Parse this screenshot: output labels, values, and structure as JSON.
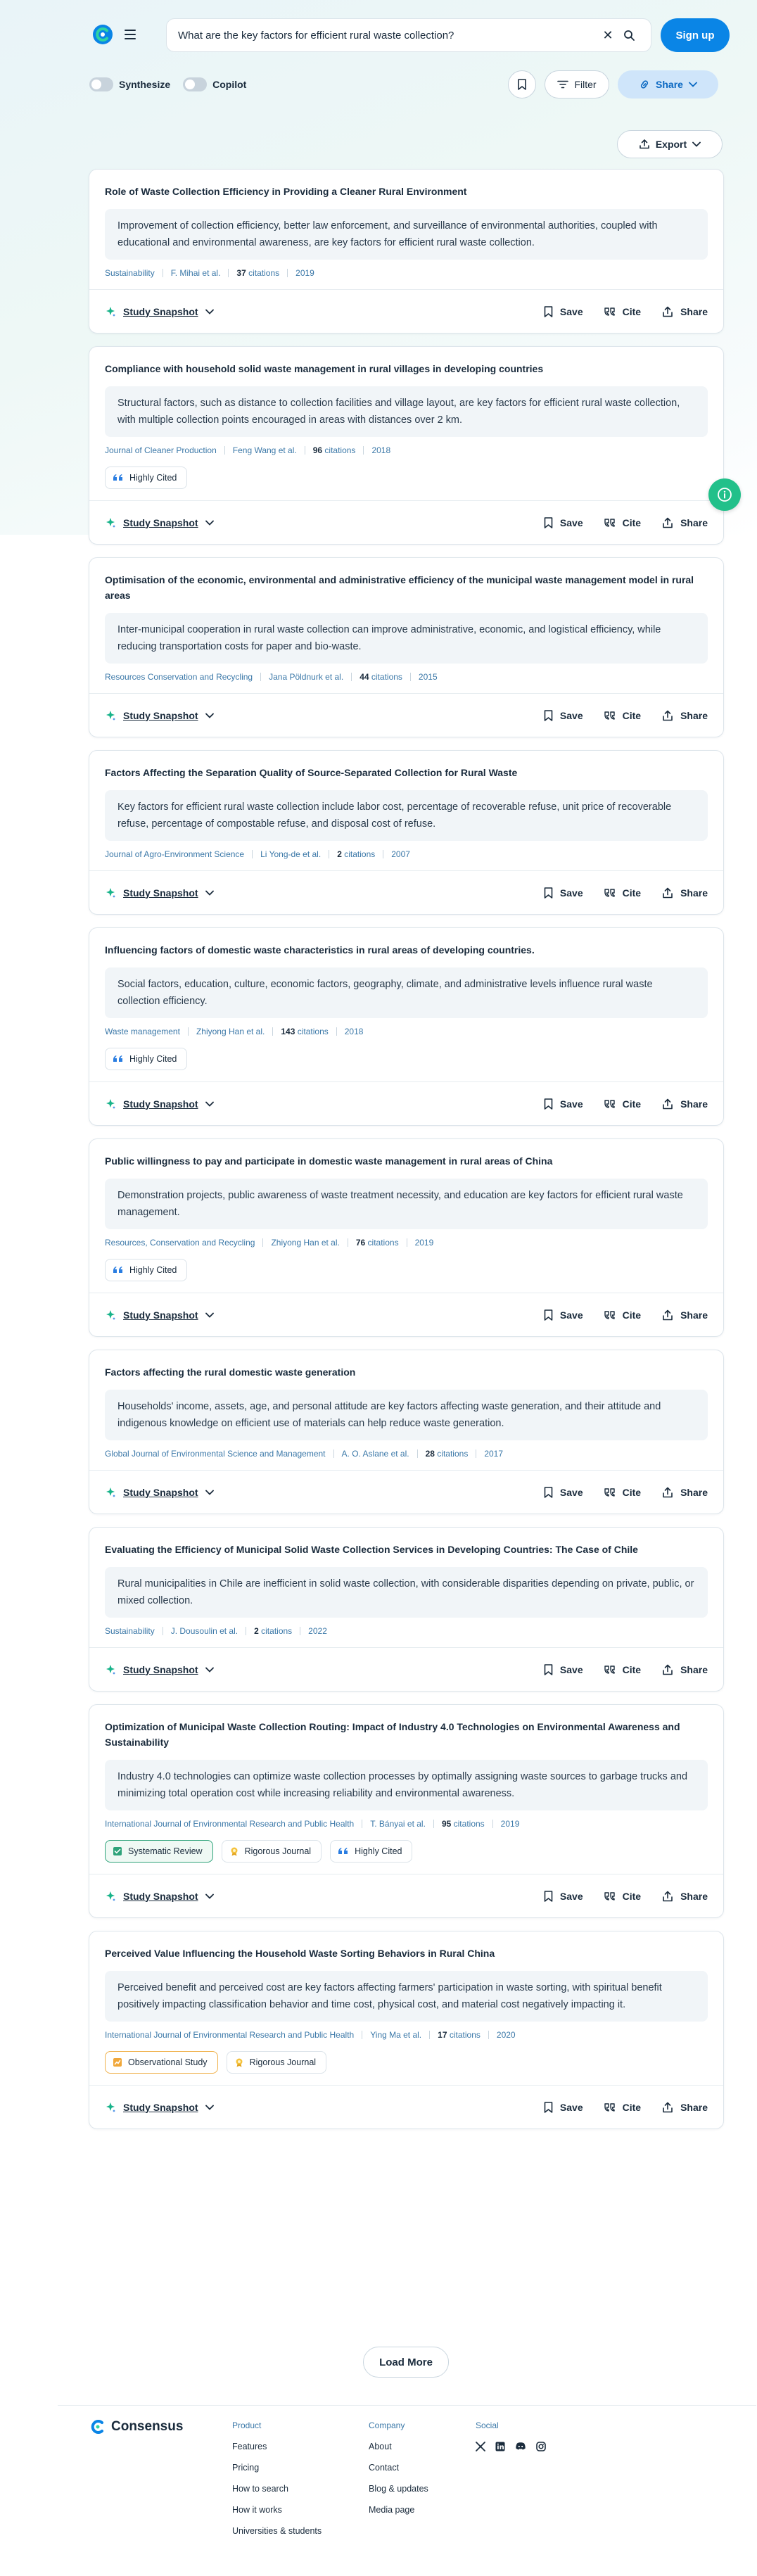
{
  "header": {
    "search_query": "What are the key factors for efficient rural waste collection?",
    "signup_label": "Sign up"
  },
  "toggles": [
    {
      "label": "Synthesize"
    },
    {
      "label": "Copilot"
    }
  ],
  "actions": {
    "filter_label": "Filter",
    "share_label": "Share",
    "export_label": "Export"
  },
  "card_actions": {
    "snapshot_label": "Study Snapshot",
    "save_label": "Save",
    "cite_label": "Cite",
    "share_label": "Share"
  },
  "results": [
    {
      "title": "Role of Waste Collection Efficiency in Providing a Cleaner Rural Environment",
      "summary": "Improvement of collection efficiency, better law enforcement, and surveillance of environmental authorities, coupled with educational and environmental awareness, are key factors for efficient rural waste collection.",
      "journal": "Sustainability",
      "authors": "F. Mihai et al.",
      "citations": "37",
      "citations_label": "citations",
      "year": "2019",
      "badges": []
    },
    {
      "title": "Compliance with household solid waste management in rural villages in developing countries",
      "summary": "Structural factors, such as distance to collection facilities and village layout, are key factors for efficient rural waste collection, with multiple collection points encouraged in areas with distances over 2 km.",
      "journal": "Journal of Cleaner Production",
      "authors": "Feng Wang et al.",
      "citations": "96",
      "citations_label": "citations",
      "year": "2018",
      "badges": [
        {
          "label": "Highly Cited",
          "type": "cited"
        }
      ]
    },
    {
      "title": "Optimisation of the economic, environmental and administrative efficiency of the municipal waste management model in rural areas",
      "summary": "Inter-municipal cooperation in rural waste collection can improve administrative, economic, and logistical efficiency, while reducing transportation costs for paper and bio-waste.",
      "journal": "Resources Conservation and Recycling",
      "authors": "Jana Pöldnurk et al.",
      "citations": "44",
      "citations_label": "citations",
      "year": "2015",
      "badges": []
    },
    {
      "title": "Factors Affecting the Separation Quality of Source-Separated Collection for Rural Waste",
      "summary": "Key factors for efficient rural waste collection include labor cost, percentage of recoverable refuse, unit price of recoverable refuse, percentage of compostable refuse, and disposal cost of refuse.",
      "journal": "Journal of Agro-Environment Science",
      "authors": "Li Yong-de et al.",
      "citations": "2",
      "citations_label": "citations",
      "year": "2007",
      "badges": []
    },
    {
      "title": "Influencing factors of domestic waste characteristics in rural areas of developing countries.",
      "summary": "Social factors, education, culture, economic factors, geography, climate, and administrative levels influence rural waste collection efficiency.",
      "journal": "Waste management",
      "authors": "Zhiyong Han et al.",
      "citations": "143",
      "citations_label": "citations",
      "year": "2018",
      "badges": [
        {
          "label": "Highly Cited",
          "type": "cited"
        }
      ]
    },
    {
      "title": "Public willingness to pay and participate in domestic waste management in rural areas of China",
      "summary": "Demonstration projects, public awareness of waste treatment necessity, and education are key factors for efficient rural waste management.",
      "journal": "Resources, Conservation and Recycling",
      "authors": "Zhiyong Han et al.",
      "citations": "76",
      "citations_label": "citations",
      "year": "2019",
      "badges": [
        {
          "label": "Highly Cited",
          "type": "cited"
        }
      ]
    },
    {
      "title": "Factors affecting the rural domestic waste generation",
      "summary": "Households' income, assets, age, and personal attitude are key factors affecting waste generation, and their attitude and indigenous knowledge on efficient use of materials can help reduce waste generation.",
      "journal": "Global Journal of Environmental Science and Management",
      "authors": "A. O. Aslane et al.",
      "citations": "28",
      "citations_label": "citations",
      "year": "2017",
      "badges": []
    },
    {
      "title": "Evaluating the Efficiency of Municipal Solid Waste Collection Services in Developing Countries: The Case of Chile",
      "summary": "Rural municipalities in Chile are inefficient in solid waste collection, with considerable disparities depending on private, public, or mixed collection.",
      "journal": "Sustainability",
      "authors": "J. Dousoulin et al.",
      "citations": "2",
      "citations_label": "citations",
      "year": "2022",
      "badges": []
    },
    {
      "title": "Optimization of Municipal Waste Collection Routing: Impact of Industry 4.0 Technologies on Environmental Awareness and Sustainability",
      "summary": "Industry 4.0 technologies can optimize waste collection processes by optimally assigning waste sources to garbage trucks and minimizing total operation cost while increasing reliability and environmental awareness.",
      "journal": "International Journal of Environmental Research and Public Health",
      "authors": "T. Bányai et al.",
      "citations": "95",
      "citations_label": "citations",
      "year": "2019",
      "badges": [
        {
          "label": "Systematic Review",
          "type": "review"
        },
        {
          "label": "Rigorous Journal",
          "type": "rigorous"
        },
        {
          "label": "Highly Cited",
          "type": "cited"
        }
      ]
    },
    {
      "title": "Perceived Value Influencing the Household Waste Sorting Behaviors in Rural China",
      "summary": "Perceived benefit and perceived cost are key factors affecting farmers' participation in waste sorting, with spiritual benefit positively impacting classification behavior and time cost, physical cost, and material cost negatively impacting it.",
      "journal": "International Journal of Environmental Research and Public Health",
      "authors": "Ying Ma et al.",
      "citations": "17",
      "citations_label": "citations",
      "year": "2020",
      "badges": [
        {
          "label": "Observational Study",
          "type": "observational"
        },
        {
          "label": "Rigorous Journal",
          "type": "rigorous"
        }
      ]
    }
  ],
  "load_more_label": "Load More",
  "footer": {
    "brand": "Consensus",
    "product_heading": "Product",
    "product_links": [
      "Features",
      "Pricing",
      "How to search",
      "How it works",
      "Universities & students"
    ],
    "company_heading": "Company",
    "company_links": [
      "About",
      "Contact",
      "Blog & updates",
      "Media page"
    ],
    "social_heading": "Social",
    "social_icons": [
      "x-icon",
      "linkedin-icon",
      "discord-icon",
      "instagram-icon"
    ]
  },
  "colors": {
    "accent": "#0a85e6",
    "help": "#22c08a",
    "meta": "#3b78a8"
  }
}
